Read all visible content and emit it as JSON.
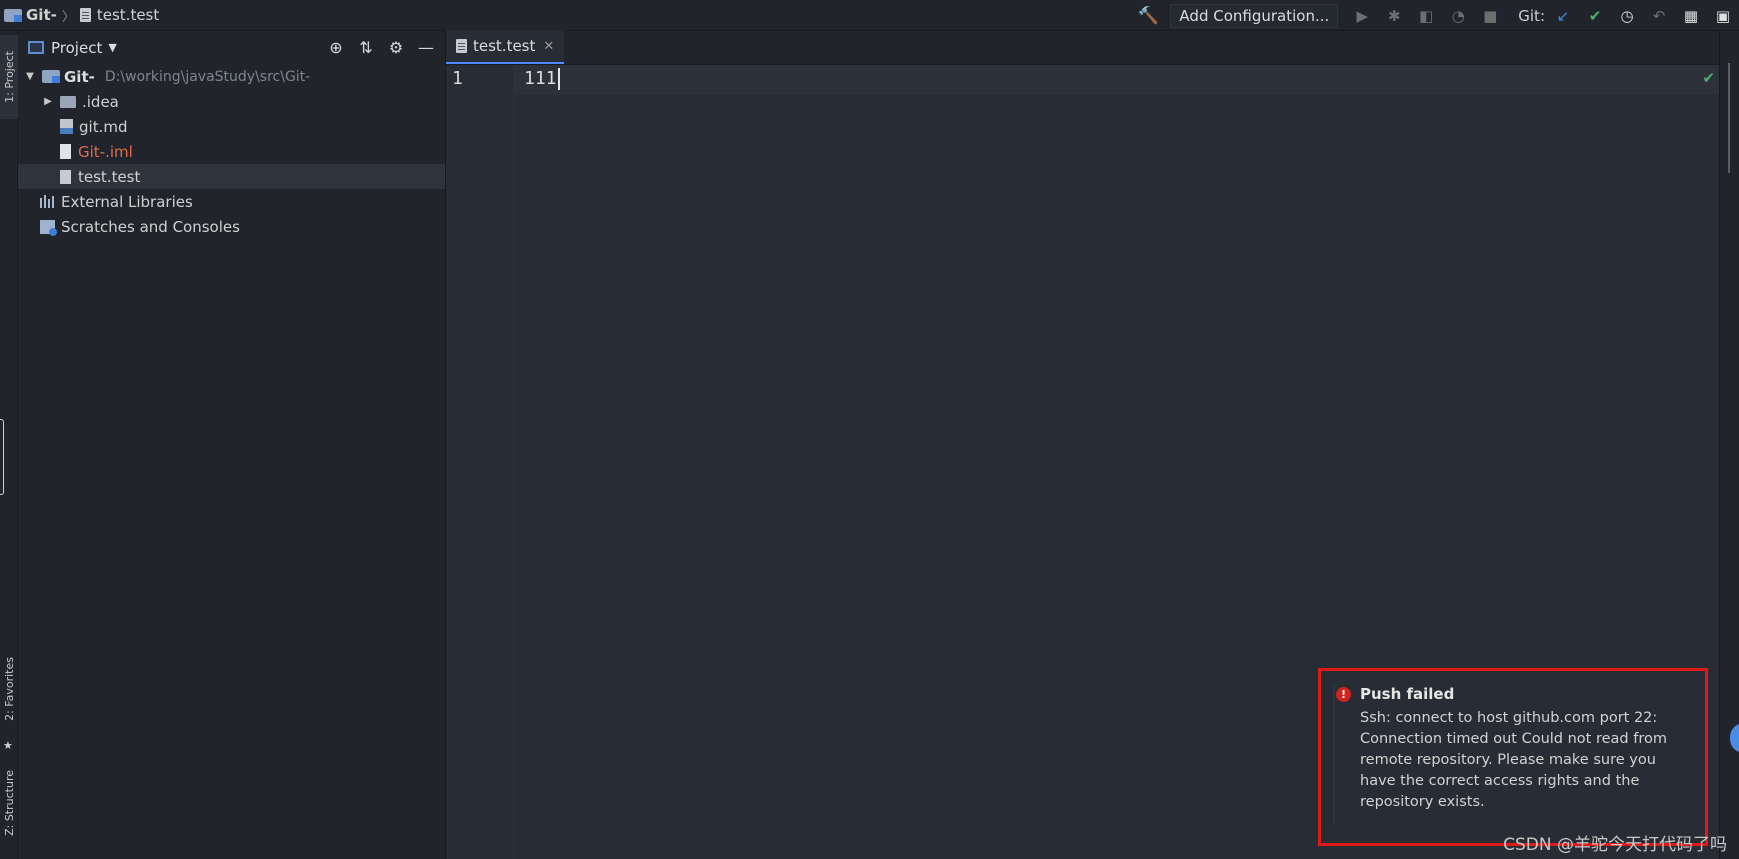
{
  "breadcrumbs": {
    "project": "Git-",
    "file": "test.test"
  },
  "toolbar": {
    "add_configuration": "Add Configuration...",
    "git_label": "Git:",
    "icons": [
      "hammer-icon",
      "run-icon",
      "debug-icon",
      "coverage-icon",
      "profile-icon",
      "stop-icon",
      "git-update-icon",
      "git-commit-icon",
      "git-history-icon",
      "git-rollback-icon",
      "project-structure-icon",
      "terminal-icon"
    ]
  },
  "left_strip": {
    "project_tab": "1: Project",
    "favorites_tab": "2: Favorites",
    "structure_tab": "Z: Structure"
  },
  "project_panel": {
    "title": "Project",
    "root": {
      "name": "Git-",
      "path": "D:\\working\\javaStudy\\src\\Git-"
    },
    "items": [
      {
        "name": ".idea",
        "type": "folder"
      },
      {
        "name": "git.md",
        "type": "md"
      },
      {
        "name": "Git-.iml",
        "type": "iml"
      },
      {
        "name": "test.test",
        "type": "text"
      }
    ],
    "external_libraries": "External Libraries",
    "scratches": "Scratches and Consoles"
  },
  "editor": {
    "tab_label": "test.test",
    "lines": [
      {
        "number": "1",
        "text": "111"
      }
    ]
  },
  "notification": {
    "title": "Push failed",
    "body": "Ssh: connect to host github.com port 22: Connection timed out Could not read from remote repository. Please make sure you have the correct access rights and the repository exists."
  },
  "watermark": "CSDN @羊驼今天打代码了吗",
  "colors": {
    "accent": "#528bff",
    "error": "#d0241e",
    "highlight_border": "#e01818",
    "success": "#4caf70"
  }
}
